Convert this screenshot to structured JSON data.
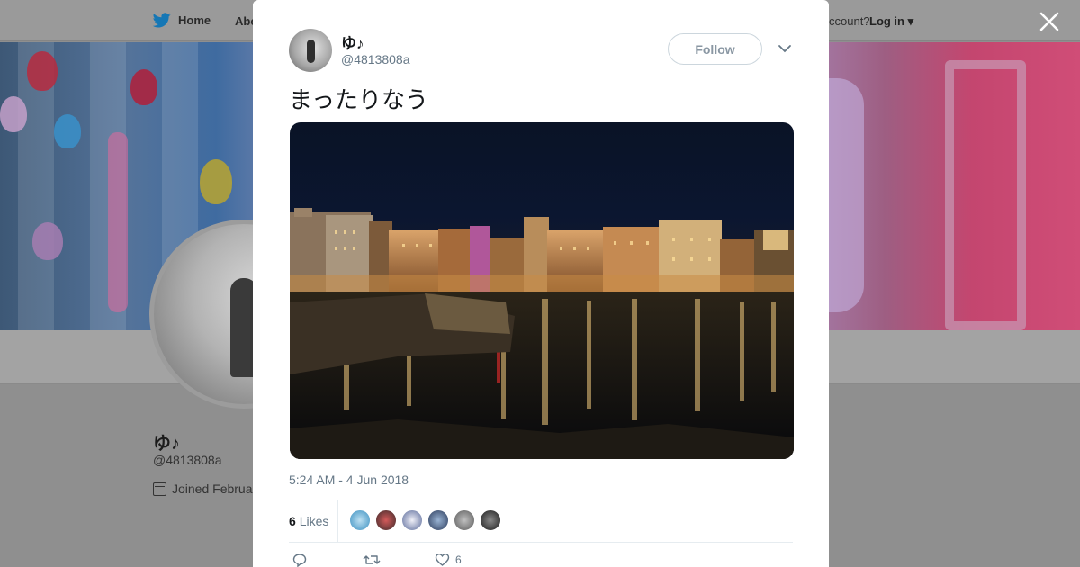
{
  "nav": {
    "home_label": "Home",
    "about_label": "Abo",
    "account_prompt": "ccount?",
    "login_label": "Log in"
  },
  "profile": {
    "name": "ゆ♪",
    "handle": "@4813808a",
    "joined": "Joined Februa"
  },
  "tweet": {
    "author_name": "ゆ♪",
    "author_handle": "@4813808a",
    "follow_label": "Follow",
    "text": "まったりなう",
    "timestamp": "5:24 AM - 4 Jun 2018",
    "likes_count": "6",
    "likes_label": "Likes",
    "like_action_count": "6"
  },
  "icons": {
    "brand": "twitter-bird-icon",
    "close": "close-icon",
    "more": "chevron-down-icon",
    "reply": "reply-icon",
    "retweet": "retweet-icon",
    "like": "heart-icon",
    "calendar": "calendar-icon"
  },
  "colors": {
    "brand_blue": "#1da1f2",
    "text_primary": "#14171a",
    "text_secondary": "#657786",
    "border": "#e6ecf0",
    "overlay": "#8f8f8f"
  }
}
